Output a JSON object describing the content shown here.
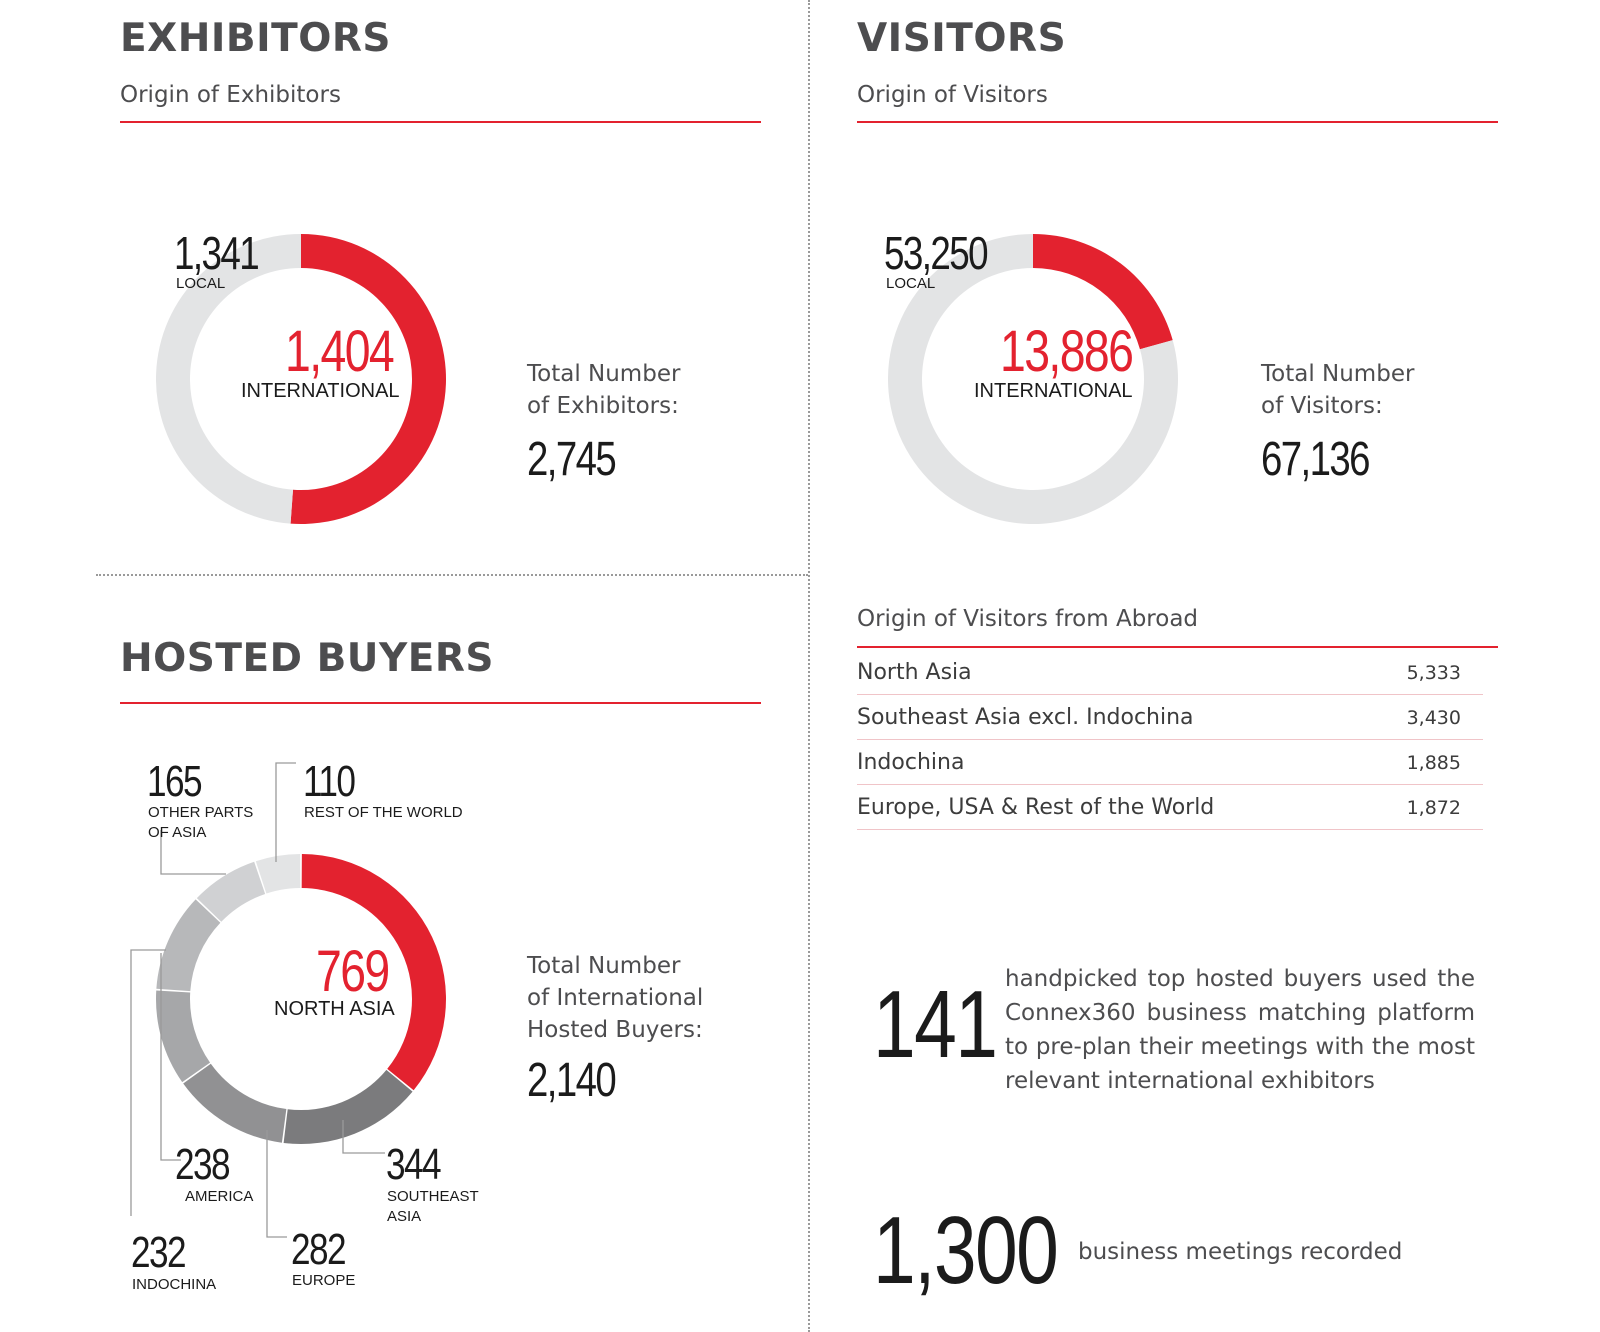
{
  "exhibitors": {
    "title": "EXHIBITORS",
    "subtitle": "Origin of Exhibitors",
    "local_value": "1,341",
    "local_label": "LOCAL",
    "intl_value": "1,404",
    "intl_label": "INTERNATIONAL",
    "total_label_1": "Total Number",
    "total_label_2": "of Exhibitors:",
    "total_value": "2,745"
  },
  "visitors": {
    "title": "VISITORS",
    "subtitle": "Origin of Visitors",
    "local_value": "53,250",
    "local_label": "LOCAL",
    "intl_value": "13,886",
    "intl_label": "INTERNATIONAL",
    "total_label_1": "Total Number",
    "total_label_2": "of Visitors:",
    "total_value": "67,136"
  },
  "buyers": {
    "title": "HOSTED BUYERS",
    "main_value": "769",
    "main_label": "NORTH ASIA",
    "total_label_1": "Total Number",
    "total_label_2": "of International",
    "total_label_3": "Hosted Buyers:",
    "total_value": "2,140",
    "callouts": {
      "other_asia": {
        "value": "165",
        "label_1": "OTHER PARTS",
        "label_2": "OF ASIA"
      },
      "rest_world": {
        "value": "110",
        "label_1": "REST OF THE WORLD"
      },
      "america": {
        "value": "238",
        "label_1": "AMERICA"
      },
      "indochina": {
        "value": "232",
        "label_1": "INDOCHINA"
      },
      "europe": {
        "value": "282",
        "label_1": "EUROPE"
      },
      "southeast_asia": {
        "value": "344",
        "label_1": "SOUTHEAST",
        "label_2": "ASIA"
      }
    }
  },
  "abroad": {
    "title": "Origin of Visitors from Abroad",
    "rows": [
      {
        "name": "North Asia",
        "value": "5,333"
      },
      {
        "name": "Southeast Asia excl. Indochina",
        "value": "3,430"
      },
      {
        "name": "Indochina",
        "value": "1,885"
      },
      {
        "name": "Europe, USA & Rest of the World",
        "value": "1,872"
      }
    ]
  },
  "stats": {
    "buyers_count": "141",
    "buyers_text": "handpicked top hosted buyers used the Connex360 business matching platform to pre-plan their meetings with the most relevant international exhibitors",
    "meetings_count": "1,300",
    "meetings_text": "business meetings recorded"
  },
  "colors": {
    "accent": "#e3222f",
    "track": "#e3e4e5",
    "greys": [
      "#ededee",
      "#d0d1d3",
      "#b7b8ba",
      "#a6a7a9",
      "#919193",
      "#7b7b7d"
    ]
  },
  "chart_data": [
    {
      "type": "pie",
      "variant": "donut",
      "title": "Origin of Exhibitors",
      "categories": [
        "INTERNATIONAL",
        "LOCAL"
      ],
      "values": [
        1404,
        1341
      ],
      "colors": [
        "#e3222f",
        "#e3e4e5"
      ]
    },
    {
      "type": "pie",
      "variant": "donut",
      "title": "Origin of Visitors",
      "categories": [
        "INTERNATIONAL",
        "LOCAL"
      ],
      "values": [
        13886,
        53250
      ],
      "colors": [
        "#e3222f",
        "#e3e4e5"
      ]
    },
    {
      "type": "pie",
      "variant": "donut",
      "title": "HOSTED BUYERS",
      "categories": [
        "NORTH ASIA",
        "SOUTHEAST ASIA",
        "EUROPE",
        "INDOCHINA",
        "AMERICA",
        "OTHER PARTS OF ASIA",
        "REST OF THE WORLD"
      ],
      "values": [
        769,
        344,
        282,
        232,
        238,
        165,
        110
      ],
      "colors": [
        "#e3222f",
        "#7b7b7d",
        "#919193",
        "#a6a7a9",
        "#b7b8ba",
        "#d0d1d3",
        "#e3e4e5"
      ]
    },
    {
      "type": "table",
      "title": "Origin of Visitors from Abroad",
      "categories": [
        "North Asia",
        "Southeast Asia excl. Indochina",
        "Indochina",
        "Europe, USA & Rest of the World"
      ],
      "values": [
        5333,
        3430,
        1885,
        1872
      ]
    }
  ]
}
